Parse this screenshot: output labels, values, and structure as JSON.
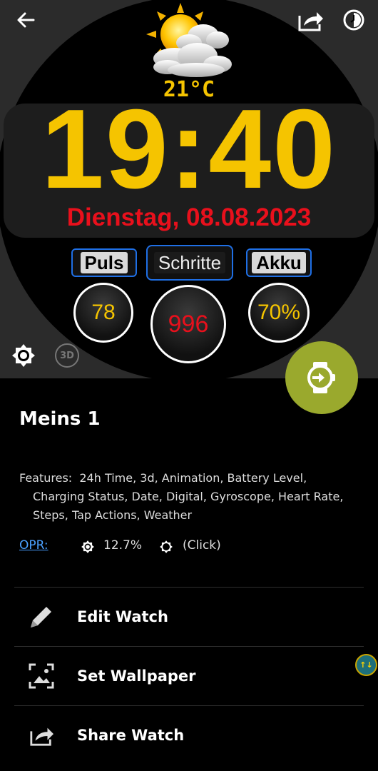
{
  "watch_face": {
    "temperature": "21°C",
    "time": "19:40",
    "date": "Dienstag, 08.08.2023",
    "labels": {
      "pulse": "Puls",
      "steps": "Schritte",
      "battery": "Akku"
    },
    "values": {
      "pulse": "78",
      "steps": "996",
      "battery": "70%"
    },
    "badge_3d": "3D"
  },
  "watch": {
    "name": "Meins 1",
    "features_label": "Features:",
    "features_line1": "24h Time,  3d,  Animation,  Battery Level,",
    "features_line2": "Charging Status,  Date,  Digital,  Gyroscope,  Heart Rate,",
    "features_line3": "Steps,  Tap Actions,  Weather",
    "opr_label": "OPR:",
    "opr_value": "12.7%",
    "opr_click": "(Click)"
  },
  "actions": {
    "edit": "Edit Watch",
    "wallpaper": "Set Wallpaper",
    "share": "Share Watch"
  },
  "floating_badge": "↑↓",
  "colors": {
    "accent_yellow": "#f5c400",
    "date_red": "#e8101c",
    "fab_green": "#9aa92d",
    "link_blue": "#4aa0ff"
  }
}
